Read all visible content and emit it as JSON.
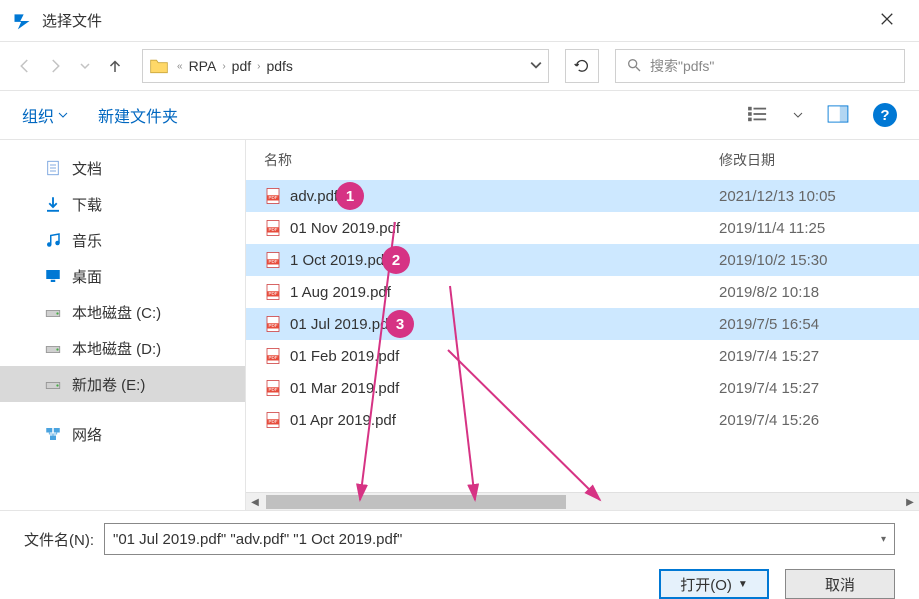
{
  "title": "选择文件",
  "breadcrumb": [
    "RPA",
    "pdf",
    "pdfs"
  ],
  "search_placeholder": "搜索\"pdfs\"",
  "toolbar": {
    "organize": "组织",
    "newfolder": "新建文件夹"
  },
  "columns": {
    "name": "名称",
    "date": "修改日期"
  },
  "sidebar": {
    "items": [
      {
        "label": "文档",
        "icon": "doc"
      },
      {
        "label": "下载",
        "icon": "download"
      },
      {
        "label": "音乐",
        "icon": "music"
      },
      {
        "label": "桌面",
        "icon": "desktop"
      },
      {
        "label": "本地磁盘 (C:)",
        "icon": "drive"
      },
      {
        "label": "本地磁盘 (D:)",
        "icon": "drive"
      },
      {
        "label": "新加卷 (E:)",
        "icon": "drive",
        "selected": true
      },
      {
        "label": "网络",
        "icon": "network"
      }
    ]
  },
  "files": [
    {
      "name": "adv.pdf",
      "date": "2021/12/13 10:05",
      "selected": true,
      "badge": "1"
    },
    {
      "name": "01 Nov 2019.pdf",
      "date": "2019/11/4 11:25"
    },
    {
      "name": "1 Oct 2019.pdf",
      "date": "2019/10/2 15:30",
      "selected": true,
      "badge": "2"
    },
    {
      "name": "1 Aug 2019.pdf",
      "date": "2019/8/2 10:18"
    },
    {
      "name": "01 Jul 2019.pdf",
      "date": "2019/7/5 16:54",
      "selected": true,
      "badge": "3"
    },
    {
      "name": "01 Feb 2019.pdf",
      "date": "2019/7/4 15:27"
    },
    {
      "name": "01 Mar 2019.pdf",
      "date": "2019/7/4 15:27"
    },
    {
      "name": "01 Apr 2019.pdf",
      "date": "2019/7/4 15:26"
    }
  ],
  "filename_label": "文件名(N):",
  "filename_value": "\"01 Jul 2019.pdf\" \"adv.pdf\" \"1 Oct 2019.pdf\"",
  "buttons": {
    "open": "打开(O)",
    "cancel": "取消"
  }
}
